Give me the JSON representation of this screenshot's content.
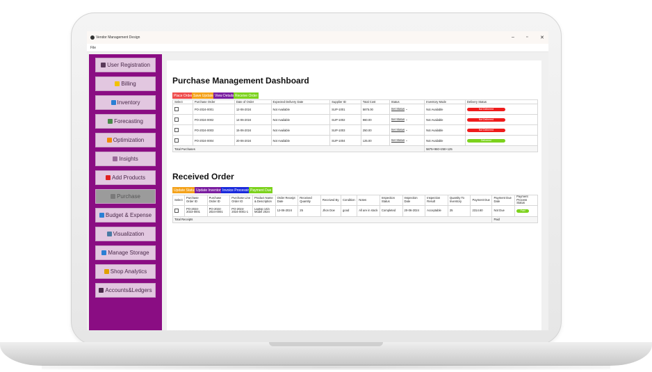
{
  "window": {
    "title": "Vendor Management Design",
    "minimize": "–",
    "maximize": "▫",
    "close": "✕",
    "menu": "File"
  },
  "sidebar": {
    "items": [
      {
        "label": "User Registration",
        "icon": "user-icon",
        "icon_color": "#5a3a5a"
      },
      {
        "label": "Billing",
        "icon": "coin-icon",
        "icon_color": "#f2c200"
      },
      {
        "label": "Inventory",
        "icon": "box-icon",
        "icon_color": "#2a7fd4"
      },
      {
        "label": "Forecasting",
        "icon": "trend-icon",
        "icon_color": "#4a8a4a"
      },
      {
        "label": "Optimization",
        "icon": "gear-icon",
        "icon_color": "#f08a00"
      },
      {
        "label": "Insights",
        "icon": "bulb-icon",
        "icon_color": "#9a6a9a"
      },
      {
        "label": "Add Products",
        "icon": "play-icon",
        "icon_color": "#e02020"
      },
      {
        "label": "Purchase",
        "icon": "cart-icon",
        "icon_color": "#7a7a7a"
      },
      {
        "label": "Budget & Expense",
        "icon": "wallet-icon",
        "icon_color": "#2a7fd4"
      },
      {
        "label": "Visualization",
        "icon": "chart-icon",
        "icon_color": "#4a7aa4"
      },
      {
        "label": "Manage Storage",
        "icon": "storage-icon",
        "icon_color": "#2a7fd4"
      },
      {
        "label": "Shop Analytics",
        "icon": "trophy-icon",
        "icon_color": "#e0a000"
      },
      {
        "label": "Accounts&Ledgers",
        "icon": "ledger-icon",
        "icon_color": "#4a2a4a"
      }
    ],
    "active": "Purchase"
  },
  "purchase": {
    "title": "Purchase Management Dashboard",
    "buttons": [
      {
        "label": "Place Order",
        "color": "#ef4a4a"
      },
      {
        "label": "Save Update",
        "color": "#f4a21a"
      },
      {
        "label": "View Details",
        "color": "#7a1ea0"
      },
      {
        "label": "Receive Order",
        "color": "#7cd21c"
      }
    ],
    "headers": [
      "Select",
      "Purchase Order",
      "Date of Order",
      "Expected Delivery Date",
      "Supplier ID",
      "Total Cost",
      "Status",
      "Inventory Mode",
      "Delivery Status"
    ],
    "rows": [
      {
        "po": "PO-2024-0001",
        "date": "12-06-2024",
        "expected": "Not Available",
        "supplier": "SUP-1001",
        "cost": "5875.00",
        "status": "Set Status",
        "mode": "Not Available",
        "delivery": "Not Delivered",
        "delivery_color": "#ef1c1c"
      },
      {
        "po": "PO-2024-0002",
        "date": "14-06-2024",
        "expected": "Not Available",
        "supplier": "SUP-1002",
        "cost": "960.00",
        "status": "Set Status",
        "mode": "Not Available",
        "delivery": "Not Delivered",
        "delivery_color": "#ef1c1c"
      },
      {
        "po": "PO-2024-0003",
        "date": "15-06-2024",
        "expected": "Not Available",
        "supplier": "SUP-1003",
        "cost": "250.00",
        "status": "Set Status",
        "mode": "Not Available",
        "delivery": "Not Delivered",
        "delivery_color": "#ef1c1c"
      },
      {
        "po": "PO-2024-0004",
        "date": "20-06-2024",
        "expected": "Not Available",
        "supplier": "SUP-1004",
        "cost": "125.00",
        "status": "Set Status",
        "mode": "Not Available",
        "delivery": "Delivered",
        "delivery_color": "#7cd21c"
      }
    ],
    "total_label": "Total Purchases",
    "total_value": "5875+960+250+125"
  },
  "received": {
    "title": "Received Order",
    "buttons": [
      {
        "label": "Update Status",
        "color": "#f4a21a"
      },
      {
        "label": "Update Inventory",
        "color": "#7a1ea0"
      },
      {
        "label": "Invoice Processing",
        "color": "#1a2adc"
      },
      {
        "label": "Payment Due",
        "color": "#7cd21c"
      }
    ],
    "headers": [
      "Select",
      "Purchase Order ID",
      "Purchase Order ID",
      "Purchase Line Order ID",
      "Product Name & Description",
      "Order Receipt Date",
      "Received Quantity",
      "Received By",
      "Condition",
      "Notes",
      "Inspection Status",
      "Inspection Date",
      "Inspection Result",
      "Quantity To Inventory",
      "Payment Due",
      "Payment Due Date",
      "Payment Process Status"
    ],
    "row": {
      "a": "PO-2024-2023-0001",
      "b": "PO-2024-2024-0001",
      "c": "PO-2024-2024-0001-1",
      "d": "Laptop 14in Model 2024",
      "e": "12-06-2024",
      "f": "25",
      "g": "Jhon Doe",
      "h": "good",
      "i": "All are in stock",
      "j": "Completed",
      "k": "20-06-2024",
      "l": "Acceptable",
      "m": "25",
      "n": "2314.60",
      "o": "Not Due",
      "p": "Paid",
      "p_color": "#7cd21c"
    },
    "total_label": "Total Receipts",
    "total_value": "Paid"
  }
}
